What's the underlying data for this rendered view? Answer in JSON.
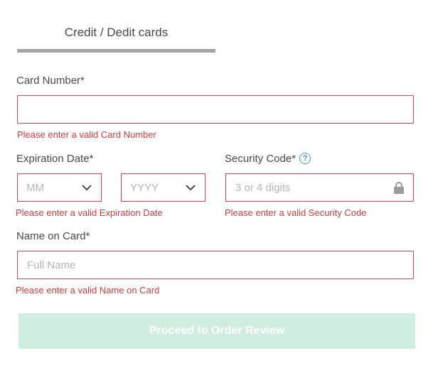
{
  "tabs": {
    "active_label": "Credit / Dedit cards"
  },
  "card_number": {
    "label": "Card Number*",
    "value": "",
    "placeholder": "",
    "error": "Please enter a valid Card Number"
  },
  "expiration": {
    "label": "Expiration Date*",
    "month_value": "MM",
    "year_value": "YYYY",
    "error": "Please enter a valid Expiration Date"
  },
  "security_code": {
    "label": "Security Code*",
    "help_glyph": "?",
    "placeholder": "3 or 4 digits",
    "error": "Please enter a valid Security Code"
  },
  "name_on_card": {
    "label": "Name on Card*",
    "placeholder": "Full Name",
    "error": "Please enter a valid Name on Card"
  },
  "submit": {
    "label": "Proceed to Order Review"
  },
  "colors": {
    "error": "#d53a3a",
    "field_border_error": "#d0444a",
    "button_disabled_bg": "#cfeedd",
    "tab_underline": "#a8a1a5",
    "help_icon": "#4a8fd4"
  },
  "icons": {
    "select_chevron": "chevron-down-icon",
    "security_help": "help-circle-icon",
    "security_lock": "lock-icon"
  }
}
